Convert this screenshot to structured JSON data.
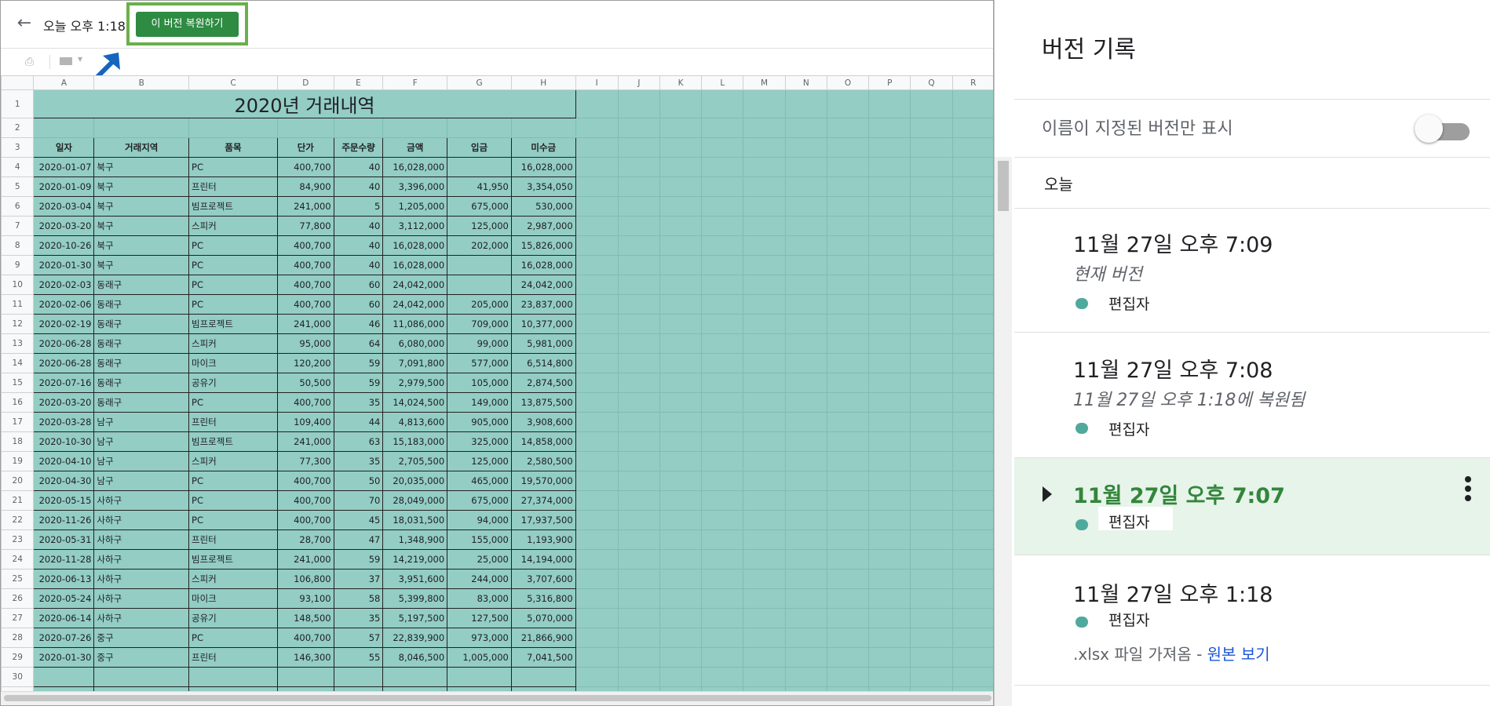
{
  "topbar": {
    "title": "오늘 오후 1:18",
    "restore_label": "이 버전 복원하기"
  },
  "icons": {
    "back": "arrow-back-icon",
    "print": "print-icon",
    "borders": "borders-icon",
    "annotation": "annotation-arrow"
  },
  "sheet": {
    "columns": [
      "A",
      "B",
      "C",
      "D",
      "E",
      "F",
      "G",
      "H",
      "I",
      "J",
      "K",
      "L",
      "M",
      "N",
      "O",
      "P",
      "Q",
      "R"
    ],
    "title": "2020년 거래내역",
    "headers": [
      "일자",
      "거래지역",
      "품목",
      "단가",
      "주문수량",
      "금액",
      "입금",
      "미수금"
    ],
    "rows": [
      [
        "2020-01-07",
        "북구",
        "PC",
        "400,700",
        "40",
        "16,028,000",
        "",
        "16,028,000"
      ],
      [
        "2020-01-09",
        "북구",
        "프린터",
        "84,900",
        "40",
        "3,396,000",
        "41,950",
        "3,354,050"
      ],
      [
        "2020-03-04",
        "북구",
        "빔프로젝트",
        "241,000",
        "5",
        "1,205,000",
        "675,000",
        "530,000"
      ],
      [
        "2020-03-20",
        "북구",
        "스피커",
        "77,800",
        "40",
        "3,112,000",
        "125,000",
        "2,987,000"
      ],
      [
        "2020-10-26",
        "북구",
        "PC",
        "400,700",
        "40",
        "16,028,000",
        "202,000",
        "15,826,000"
      ],
      [
        "2020-01-30",
        "북구",
        "PC",
        "400,700",
        "40",
        "16,028,000",
        "",
        "16,028,000"
      ],
      [
        "2020-02-03",
        "동래구",
        "PC",
        "400,700",
        "60",
        "24,042,000",
        "",
        "24,042,000"
      ],
      [
        "2020-02-06",
        "동래구",
        "PC",
        "400,700",
        "60",
        "24,042,000",
        "205,000",
        "23,837,000"
      ],
      [
        "2020-02-19",
        "동래구",
        "빔프로젝트",
        "241,000",
        "46",
        "11,086,000",
        "709,000",
        "10,377,000"
      ],
      [
        "2020-06-28",
        "동래구",
        "스피커",
        "95,000",
        "64",
        "6,080,000",
        "99,000",
        "5,981,000"
      ],
      [
        "2020-06-28",
        "동래구",
        "마이크",
        "120,200",
        "59",
        "7,091,800",
        "577,000",
        "6,514,800"
      ],
      [
        "2020-07-16",
        "동래구",
        "공유기",
        "50,500",
        "59",
        "2,979,500",
        "105,000",
        "2,874,500"
      ],
      [
        "2020-03-20",
        "동래구",
        "PC",
        "400,700",
        "35",
        "14,024,500",
        "149,000",
        "13,875,500"
      ],
      [
        "2020-03-28",
        "남구",
        "프린터",
        "109,400",
        "44",
        "4,813,600",
        "905,000",
        "3,908,600"
      ],
      [
        "2020-10-30",
        "남구",
        "빔프로젝트",
        "241,000",
        "63",
        "15,183,000",
        "325,000",
        "14,858,000"
      ],
      [
        "2020-04-10",
        "남구",
        "스피커",
        "77,300",
        "35",
        "2,705,500",
        "125,000",
        "2,580,500"
      ],
      [
        "2020-04-30",
        "남구",
        "PC",
        "400,700",
        "50",
        "20,035,000",
        "465,000",
        "19,570,000"
      ],
      [
        "2020-05-15",
        "사하구",
        "PC",
        "400,700",
        "70",
        "28,049,000",
        "675,000",
        "27,374,000"
      ],
      [
        "2020-11-26",
        "사하구",
        "PC",
        "400,700",
        "45",
        "18,031,500",
        "94,000",
        "17,937,500"
      ],
      [
        "2020-05-31",
        "사하구",
        "프린터",
        "28,700",
        "47",
        "1,348,900",
        "155,000",
        "1,193,900"
      ],
      [
        "2020-11-28",
        "사하구",
        "빔프로젝트",
        "241,000",
        "59",
        "14,219,000",
        "25,000",
        "14,194,000"
      ],
      [
        "2020-06-13",
        "사하구",
        "스피커",
        "106,800",
        "37",
        "3,951,600",
        "244,000",
        "3,707,600"
      ],
      [
        "2020-05-24",
        "사하구",
        "마이크",
        "93,100",
        "58",
        "5,399,800",
        "83,000",
        "5,316,800"
      ],
      [
        "2020-06-14",
        "사하구",
        "공유기",
        "148,500",
        "35",
        "5,197,500",
        "127,500",
        "5,070,000"
      ],
      [
        "2020-07-26",
        "중구",
        "PC",
        "400,700",
        "57",
        "22,839,900",
        "973,000",
        "21,866,900"
      ],
      [
        "2020-01-30",
        "중구",
        "프린터",
        "146,300",
        "55",
        "8,046,500",
        "1,005,000",
        "7,041,500"
      ]
    ]
  },
  "panel": {
    "title": "버전 기록",
    "named_only_label": "이름이 지정된 버전만 표시",
    "named_only_on": false,
    "today_label": "오늘",
    "versions": [
      {
        "date": "11월 27일 오후 7:09",
        "note": "현재 버전",
        "editor": "편집자"
      },
      {
        "date": "11월 27일 오후 7:08",
        "note": "11월 27일 오후 1:18에 복원됨",
        "editor": "편집자"
      },
      {
        "date": "11월 27일 오후 7:07",
        "note": "",
        "editor": "편집자"
      },
      {
        "date": "11월 27일 오후 1:18",
        "note": "",
        "editor": "편집자",
        "source_prefix": ".xlsx 파일 가져옴 - ",
        "source_link": "원본 보기"
      }
    ]
  },
  "colors": {
    "cell_fill": "#93cdc4",
    "restore_button": "#2e8b42",
    "selected_version_bg": "#e6f4ea",
    "selected_version_text": "#34853b",
    "editor_dot": "#4fa99c",
    "link": "#1a56d6"
  }
}
